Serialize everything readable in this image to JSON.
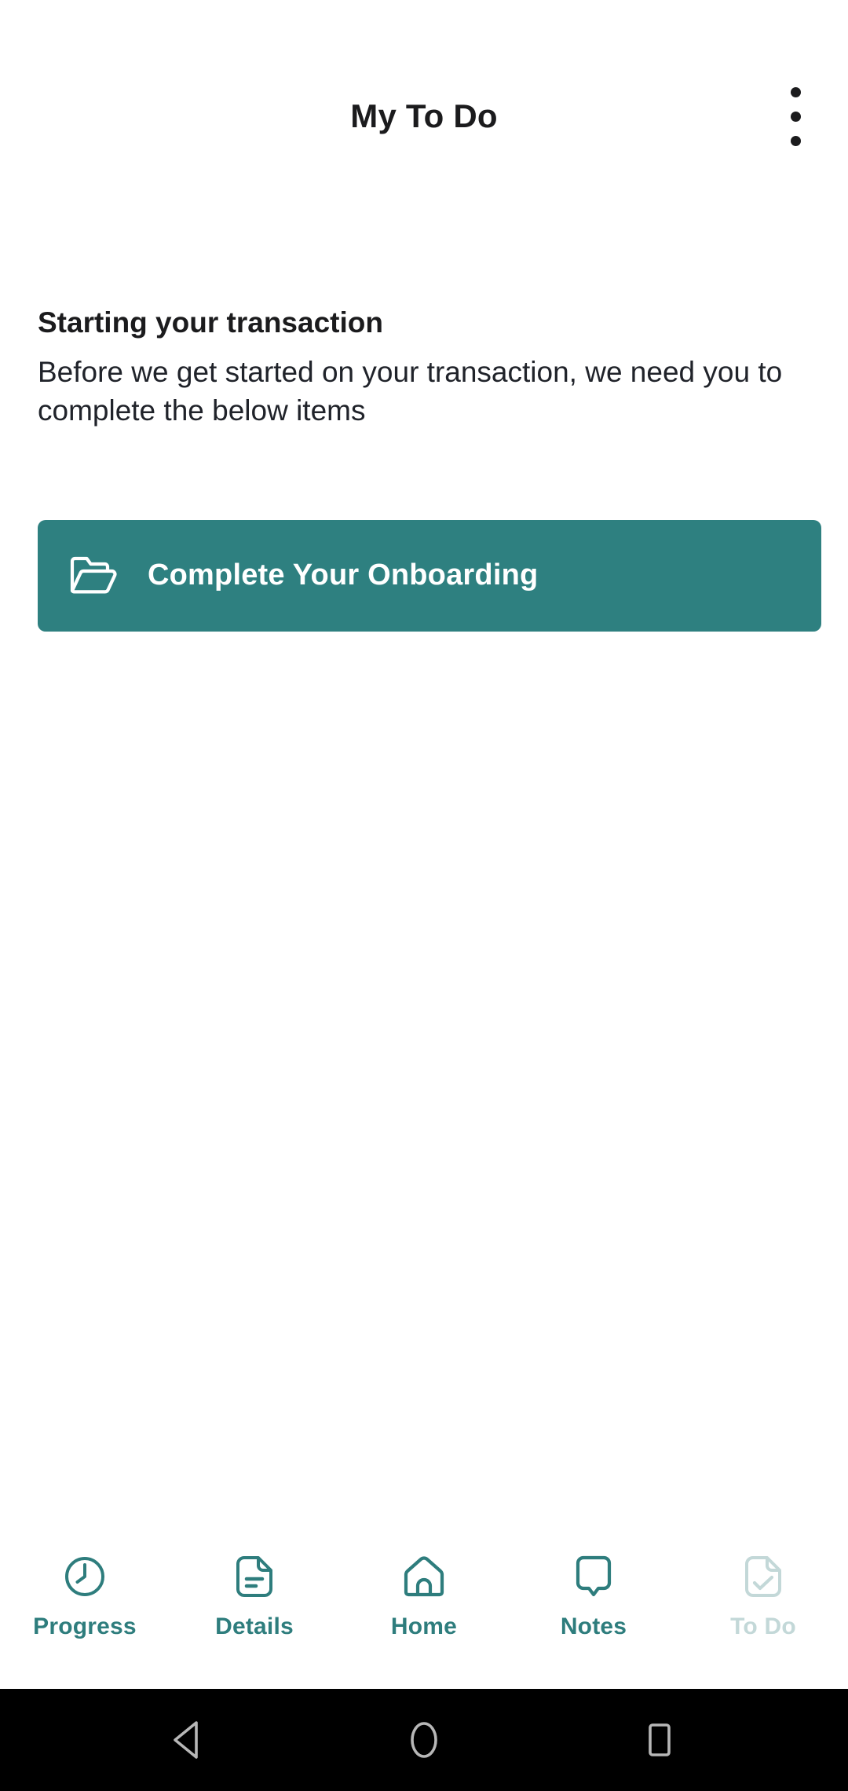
{
  "appbar": {
    "title": "My To Do",
    "overflow_icon": "more-vertical-icon"
  },
  "content": {
    "heading": "Starting your transaction",
    "body": "Before we get started on your transaction, we need you to complete the below items",
    "action_button": {
      "label": "Complete Your Onboarding",
      "icon": "open-folder-icon",
      "background_color": "#2e8080",
      "text_color": "#ffffff"
    }
  },
  "tabbar": {
    "active_color": "#2e7d7d",
    "disabled_color": "#c3d8d8",
    "items": [
      {
        "label": "Progress",
        "icon": "clock-icon",
        "state": "active"
      },
      {
        "label": "Details",
        "icon": "document-lines-icon",
        "state": "active"
      },
      {
        "label": "Home",
        "icon": "house-icon",
        "state": "active"
      },
      {
        "label": "Notes",
        "icon": "speech-bubble-icon",
        "state": "active"
      },
      {
        "label": "To Do",
        "icon": "document-check-icon",
        "state": "disabled"
      }
    ]
  },
  "system_nav": {
    "back": "back-triangle-icon",
    "home": "home-circle-icon",
    "recents": "recents-square-icon"
  }
}
